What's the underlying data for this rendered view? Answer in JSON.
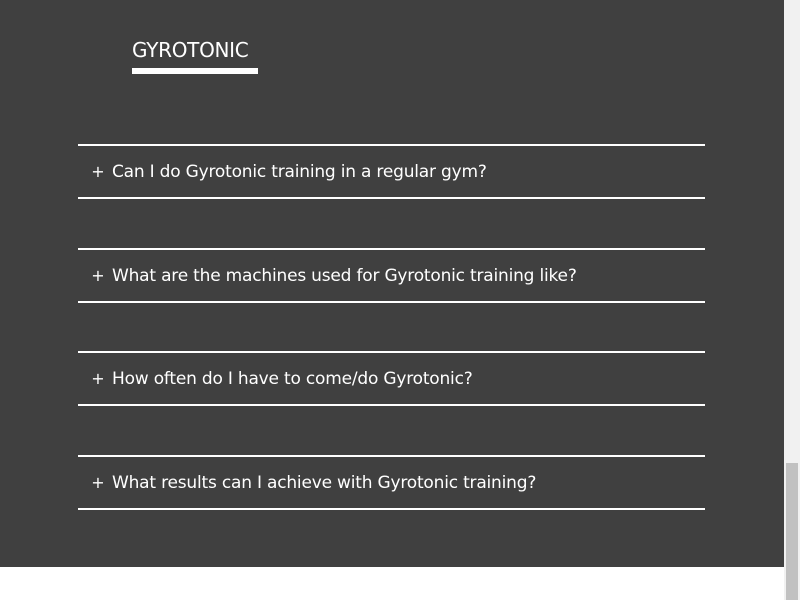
{
  "section": {
    "title": "GYROTONIC"
  },
  "faq": {
    "expand_symbol": "+",
    "items": [
      {
        "question": "Can I do Gyrotonic training in a regular gym?"
      },
      {
        "question": "What are the machines used for Gyrotonic training like?"
      },
      {
        "question": "How often do I have to come/do Gyrotonic?"
      },
      {
        "question": "What results can I achieve with Gyrotonic training?"
      }
    ]
  },
  "colors": {
    "section_background": "#404040",
    "text": "#ffffff",
    "page_background": "#ffffff",
    "scrollbar_track": "#f1f1f1",
    "scrollbar_thumb": "#c1c1c1"
  }
}
